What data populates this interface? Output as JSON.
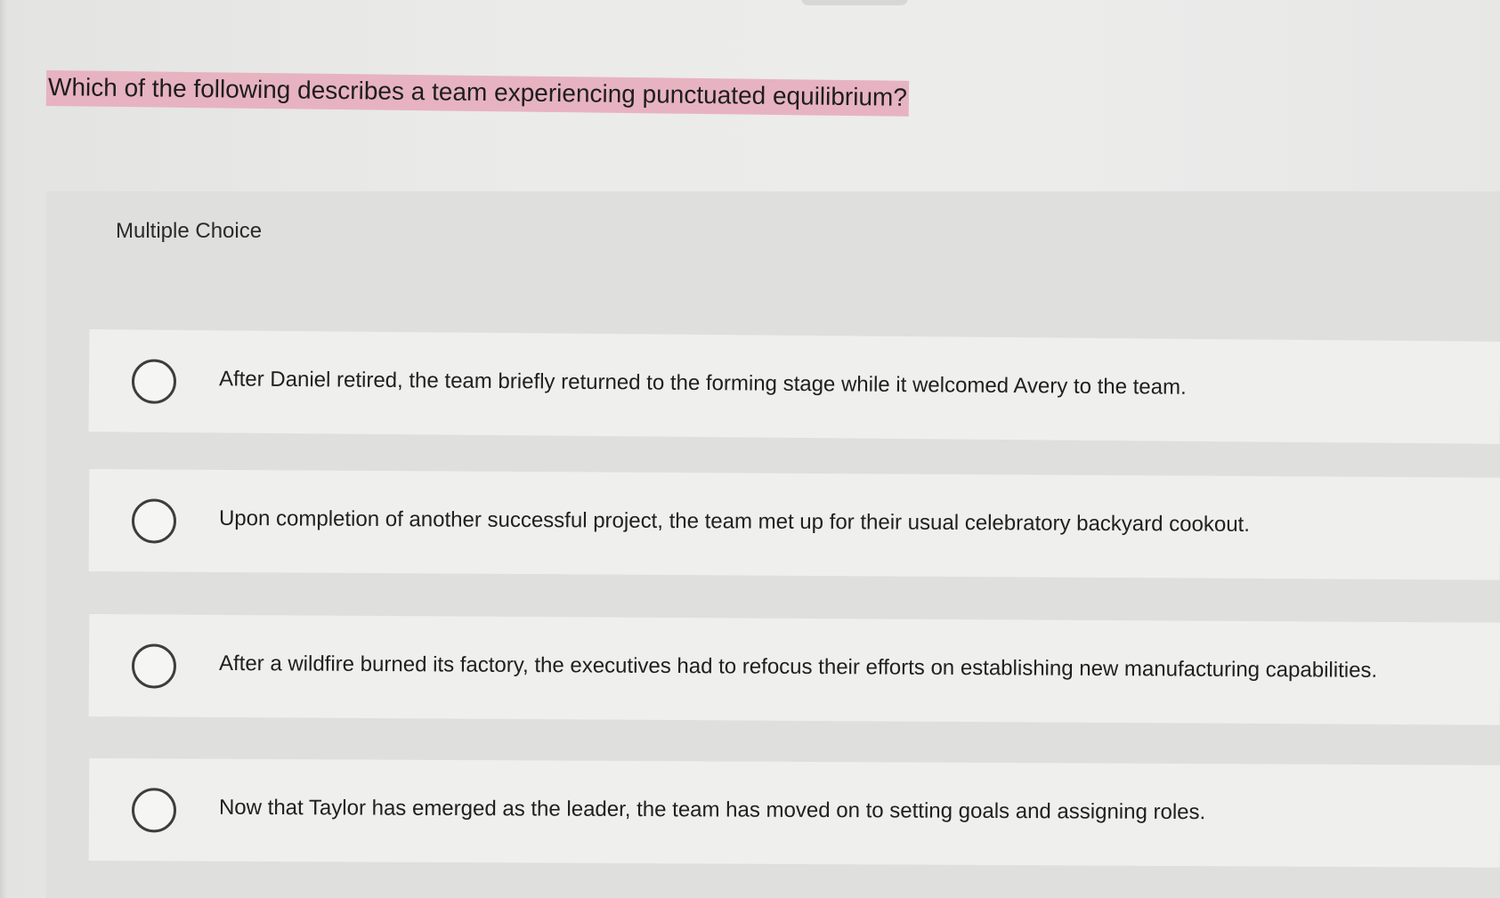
{
  "question": {
    "text": "Which of the following describes a team experiencing punctuated equilibrium?"
  },
  "multiple_choice": {
    "label": "Multiple Choice",
    "choices": [
      {
        "text": "After Daniel retired, the team briefly returned to the forming stage while it welcomed Avery to the team."
      },
      {
        "text": "Upon completion of another successful project, the team met up for their usual celebratory backyard cookout."
      },
      {
        "text": "After a wildfire burned its factory, the executives had to refocus their efforts on establishing new manufacturing capabilities."
      },
      {
        "text": "Now that Taylor has emerged as the leader, the team has moved on to setting goals and assigning roles."
      }
    ]
  },
  "colors": {
    "highlight": "#e7b3c1",
    "background": "#e6e6e4",
    "choice_background": "#efefee",
    "radio_border": "#3d3d3d"
  },
  "icons": {
    "radio_button": "radio-button-empty-icon"
  }
}
